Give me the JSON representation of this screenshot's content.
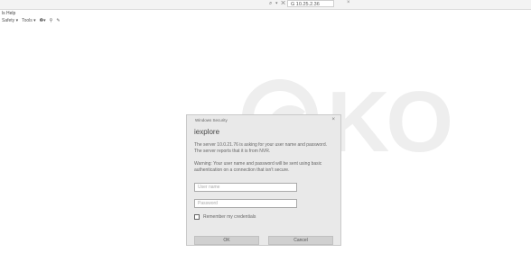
{
  "browser": {
    "nav_icons": "⌕ ▾ ✕",
    "tab_label": "G 10.25.2.36",
    "tab_close": "×"
  },
  "menubar": {
    "items": [
      "ls",
      "Help"
    ]
  },
  "cmdbar": {
    "items": [
      "Safety ▾",
      "Tools ▾",
      "❷▾",
      "⚲",
      "✎"
    ]
  },
  "watermark": {
    "text": "KO"
  },
  "dialog": {
    "window_title": "Windows Security",
    "close": "×",
    "heading": "iexplore",
    "message1": "The server 10.0.21.76 is asking for your user name and password. The server reports that it is from NVR.",
    "message2": "Warning: Your user name and password will be sent using basic authentication on a connection that isn't secure.",
    "username_placeholder": "User name",
    "password_placeholder": "Password",
    "remember_label": "Remember my credentials",
    "ok_label": "OK",
    "cancel_label": "Cancel"
  }
}
